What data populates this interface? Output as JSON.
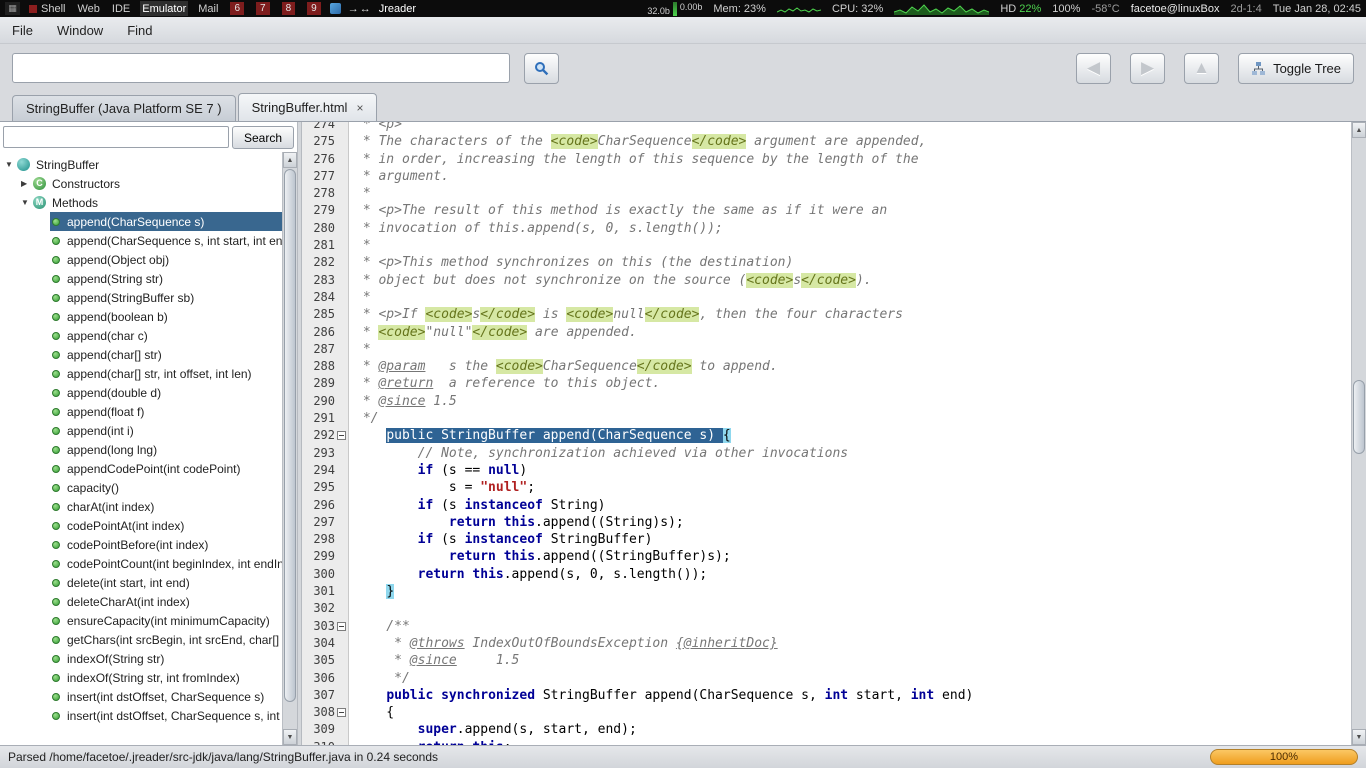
{
  "panel": {
    "workspaces": [
      {
        "label": "Shell",
        "marker": true
      },
      {
        "label": "Web"
      },
      {
        "label": "IDE"
      },
      {
        "label": "Emulator",
        "active": true
      },
      {
        "label": "Mail"
      },
      {
        "label": "6",
        "box": true
      },
      {
        "label": "7",
        "box": true
      },
      {
        "label": "8",
        "box": true
      },
      {
        "label": "9",
        "box": true
      }
    ],
    "layout_glyphs": "→↔",
    "window_title": "Jreader",
    "net_down": "32.0b",
    "net_up": "0.00b",
    "mem_label": "Mem: 23%",
    "cpu_label": "CPU: 32%",
    "hd_label": "HD",
    "hd_value": "22%",
    "battery": "100%",
    "temp": "-58°C",
    "host": "facetoe@linuxBox",
    "uptime": "2d-1:4",
    "clock": "Tue Jan 28, 02:45"
  },
  "menubar": {
    "items": [
      "File",
      "Window",
      "Find"
    ]
  },
  "toolbar": {
    "address_value": "",
    "back_glyph": "◀",
    "forward_glyph": "▶",
    "home_glyph": "▲",
    "toggle_tree_label": "Toggle Tree"
  },
  "tabs": [
    {
      "label": "StringBuffer (Java Platform SE 7 )"
    },
    {
      "label": "StringBuffer.html",
      "close": "×"
    }
  ],
  "sidebar": {
    "search_value": "",
    "search_button_label": "Search",
    "tree": [
      {
        "level": 0,
        "type": "class",
        "label": "StringBuffer",
        "arrow": "expanded"
      },
      {
        "level": 1,
        "type": "constructors",
        "label": "Constructors",
        "arrow": "collapsed"
      },
      {
        "level": 1,
        "type": "methods",
        "label": "Methods",
        "arrow": "expanded"
      },
      {
        "level": 2,
        "type": "method",
        "label": "append(CharSequence s)",
        "selected": true
      },
      {
        "level": 2,
        "type": "method",
        "label": "append(CharSequence s, int start, int end)"
      },
      {
        "level": 2,
        "type": "method",
        "label": "append(Object obj)"
      },
      {
        "level": 2,
        "type": "method",
        "label": "append(String str)"
      },
      {
        "level": 2,
        "type": "method",
        "label": "append(StringBuffer sb)"
      },
      {
        "level": 2,
        "type": "method",
        "label": "append(boolean b)"
      },
      {
        "level": 2,
        "type": "method",
        "label": "append(char c)"
      },
      {
        "level": 2,
        "type": "method",
        "label": "append(char[] str)"
      },
      {
        "level": 2,
        "type": "method",
        "label": "append(char[] str, int offset, int len)"
      },
      {
        "level": 2,
        "type": "method",
        "label": "append(double d)"
      },
      {
        "level": 2,
        "type": "method",
        "label": "append(float f)"
      },
      {
        "level": 2,
        "type": "method",
        "label": "append(int i)"
      },
      {
        "level": 2,
        "type": "method",
        "label": "append(long lng)"
      },
      {
        "level": 2,
        "type": "method",
        "label": "appendCodePoint(int codePoint)"
      },
      {
        "level": 2,
        "type": "method",
        "label": "capacity()"
      },
      {
        "level": 2,
        "type": "method",
        "label": "charAt(int index)"
      },
      {
        "level": 2,
        "type": "method",
        "label": "codePointAt(int index)"
      },
      {
        "level": 2,
        "type": "method",
        "label": "codePointBefore(int index)"
      },
      {
        "level": 2,
        "type": "method",
        "label": "codePointCount(int beginIndex, int endIndex)"
      },
      {
        "level": 2,
        "type": "method",
        "label": "delete(int start, int end)"
      },
      {
        "level": 2,
        "type": "method",
        "label": "deleteCharAt(int index)"
      },
      {
        "level": 2,
        "type": "method",
        "label": "ensureCapacity(int minimumCapacity)"
      },
      {
        "level": 2,
        "type": "method",
        "label": "getChars(int srcBegin, int srcEnd, char[] dst, int dstBegin)"
      },
      {
        "level": 2,
        "type": "method",
        "label": "indexOf(String str)"
      },
      {
        "level": 2,
        "type": "method",
        "label": "indexOf(String str, int fromIndex)"
      },
      {
        "level": 2,
        "type": "method",
        "label": "insert(int dstOffset, CharSequence s)"
      },
      {
        "level": 2,
        "type": "method",
        "label": "insert(int dstOffset, CharSequence s, int start, int end)"
      }
    ]
  },
  "editor": {
    "lines": [
      {
        "n": "274",
        "segs": [
          [
            "c",
            " * <p>"
          ]
        ]
      },
      {
        "n": "275",
        "segs": [
          [
            "c",
            " * The characters of the "
          ],
          [
            "t",
            "<code>"
          ],
          [
            "c",
            "CharSequence"
          ],
          [
            "t",
            "</code>"
          ],
          [
            "c",
            " argument are appended,"
          ]
        ]
      },
      {
        "n": "276",
        "segs": [
          [
            "c",
            " * in order, increasing the length of this sequence by the length of the"
          ]
        ]
      },
      {
        "n": "277",
        "segs": [
          [
            "c",
            " * argument."
          ]
        ]
      },
      {
        "n": "278",
        "segs": [
          [
            "c",
            " *"
          ]
        ]
      },
      {
        "n": "279",
        "segs": [
          [
            "c",
            " * <p>The result of this method is exactly the same as if it were an"
          ]
        ]
      },
      {
        "n": "280",
        "segs": [
          [
            "c",
            " * invocation of this.append(s, 0, s.length());"
          ]
        ]
      },
      {
        "n": "281",
        "segs": [
          [
            "c",
            " *"
          ]
        ]
      },
      {
        "n": "282",
        "segs": [
          [
            "c",
            " * <p>This method synchronizes on this (the destination)"
          ]
        ]
      },
      {
        "n": "283",
        "segs": [
          [
            "c",
            " * object but does not synchronize on the source ("
          ],
          [
            "t",
            "<code>"
          ],
          [
            "c",
            "s"
          ],
          [
            "t",
            "</code>"
          ],
          [
            "c",
            ")."
          ]
        ]
      },
      {
        "n": "284",
        "segs": [
          [
            "c",
            " *"
          ]
        ]
      },
      {
        "n": "285",
        "segs": [
          [
            "c",
            " * <p>If "
          ],
          [
            "t",
            "<code>"
          ],
          [
            "c",
            "s"
          ],
          [
            "t",
            "</code>"
          ],
          [
            "c",
            " is "
          ],
          [
            "t",
            "<code>"
          ],
          [
            "c",
            "null"
          ],
          [
            "t",
            "</code>"
          ],
          [
            "c",
            ", then the four characters"
          ]
        ]
      },
      {
        "n": "286",
        "segs": [
          [
            "c",
            " * "
          ],
          [
            "t",
            "<code>"
          ],
          [
            "c",
            "\"null\""
          ],
          [
            "t",
            "</code>"
          ],
          [
            "c",
            " are appended."
          ]
        ]
      },
      {
        "n": "287",
        "segs": [
          [
            "c",
            " *"
          ]
        ]
      },
      {
        "n": "288",
        "segs": [
          [
            "c",
            " * "
          ],
          [
            "u",
            "@param"
          ],
          [
            "c",
            "   s the "
          ],
          [
            "t",
            "<code>"
          ],
          [
            "c",
            "CharSequence"
          ],
          [
            "t",
            "</code>"
          ],
          [
            "c",
            " to append."
          ]
        ]
      },
      {
        "n": "289",
        "segs": [
          [
            "c",
            " * "
          ],
          [
            "u",
            "@return"
          ],
          [
            "c",
            "  a reference to this object."
          ]
        ]
      },
      {
        "n": "290",
        "segs": [
          [
            "c",
            " * "
          ],
          [
            "u",
            "@since"
          ],
          [
            "c",
            " 1.5"
          ]
        ]
      },
      {
        "n": "291",
        "segs": [
          [
            "c",
            " */"
          ]
        ]
      },
      {
        "n": "292",
        "fold": true,
        "segs": [
          [
            "p",
            "    "
          ],
          [
            "sel",
            "public StringBuffer append(CharSequence s) "
          ],
          [
            "br",
            "{"
          ]
        ]
      },
      {
        "n": "293",
        "segs": [
          [
            "p",
            "        "
          ],
          [
            "c",
            "// Note, synchronization achieved via other invocations"
          ]
        ]
      },
      {
        "n": "294",
        "segs": [
          [
            "p",
            "        "
          ],
          [
            "k",
            "if"
          ],
          [
            "p",
            " (s == "
          ],
          [
            "k",
            "null"
          ],
          [
            "p",
            ")"
          ]
        ]
      },
      {
        "n": "295",
        "segs": [
          [
            "p",
            "            s = "
          ],
          [
            "s",
            "\"null\""
          ],
          [
            "p",
            ";"
          ]
        ]
      },
      {
        "n": "296",
        "segs": [
          [
            "p",
            "        "
          ],
          [
            "k",
            "if"
          ],
          [
            "p",
            " (s "
          ],
          [
            "k",
            "instanceof"
          ],
          [
            "p",
            " String)"
          ]
        ]
      },
      {
        "n": "297",
        "segs": [
          [
            "p",
            "            "
          ],
          [
            "k",
            "return"
          ],
          [
            "p",
            " "
          ],
          [
            "k",
            "this"
          ],
          [
            "p",
            ".append((String)s);"
          ]
        ]
      },
      {
        "n": "298",
        "segs": [
          [
            "p",
            "        "
          ],
          [
            "k",
            "if"
          ],
          [
            "p",
            " (s "
          ],
          [
            "k",
            "instanceof"
          ],
          [
            "p",
            " StringBuffer)"
          ]
        ]
      },
      {
        "n": "299",
        "segs": [
          [
            "p",
            "            "
          ],
          [
            "k",
            "return"
          ],
          [
            "p",
            " "
          ],
          [
            "k",
            "this"
          ],
          [
            "p",
            ".append((StringBuffer)s);"
          ]
        ]
      },
      {
        "n": "300",
        "segs": [
          [
            "p",
            "        "
          ],
          [
            "k",
            "return"
          ],
          [
            "p",
            " "
          ],
          [
            "k",
            "this"
          ],
          [
            "p",
            ".append(s, 0, s.length());"
          ]
        ]
      },
      {
        "n": "301",
        "segs": [
          [
            "p",
            "    "
          ],
          [
            "br",
            "}"
          ]
        ]
      },
      {
        "n": "302",
        "segs": []
      },
      {
        "n": "303",
        "fold": true,
        "segs": [
          [
            "c",
            "    /**"
          ]
        ]
      },
      {
        "n": "304",
        "segs": [
          [
            "c",
            "     * "
          ],
          [
            "u",
            "@throws"
          ],
          [
            "c",
            " IndexOutOfBoundsException "
          ],
          [
            "u",
            "{@inheritDoc}"
          ]
        ]
      },
      {
        "n": "305",
        "segs": [
          [
            "c",
            "     * "
          ],
          [
            "u",
            "@since"
          ],
          [
            "c",
            "     1.5"
          ]
        ]
      },
      {
        "n": "306",
        "segs": [
          [
            "c",
            "     */"
          ]
        ]
      },
      {
        "n": "307",
        "segs": [
          [
            "p",
            "    "
          ],
          [
            "k",
            "public"
          ],
          [
            "p",
            " "
          ],
          [
            "k",
            "synchronized"
          ],
          [
            "p",
            " StringBuffer append(CharSequence s, "
          ],
          [
            "k",
            "int"
          ],
          [
            "p",
            " start, "
          ],
          [
            "k",
            "int"
          ],
          [
            "p",
            " end)"
          ]
        ]
      },
      {
        "n": "308",
        "fold": true,
        "segs": [
          [
            "p",
            "    {"
          ]
        ]
      },
      {
        "n": "309",
        "segs": [
          [
            "p",
            "        "
          ],
          [
            "k",
            "super"
          ],
          [
            "p",
            ".append(s, start, end);"
          ]
        ]
      },
      {
        "n": "310",
        "segs": [
          [
            "p",
            "        "
          ],
          [
            "k",
            "return"
          ],
          [
            "p",
            " "
          ],
          [
            "k",
            "this"
          ],
          [
            "p",
            ";"
          ]
        ]
      }
    ]
  },
  "statusbar": {
    "message": "Parsed /home/facetoe/.jreader/src-jdk/java/lang/StringBuffer.java in 0.24 seconds",
    "progress_label": "100%",
    "progress_percent": 100
  },
  "colors": {
    "selection_blue": "#2e6394",
    "tree_selection": "#39678f",
    "brace_highlight": "#8fd8ee",
    "code_tag_bg": "#d6e8a4",
    "progress_orange": "#ef9d1f",
    "panel_green": "#4ed44e",
    "panel_red": "#7e1d1d"
  }
}
